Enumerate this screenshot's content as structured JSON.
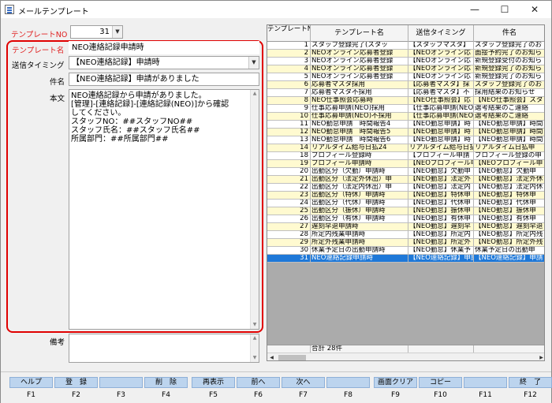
{
  "window": {
    "title": "メールテンプレート",
    "minimize_glyph": "—",
    "maximize_glyph": "☐",
    "close_glyph": "✕"
  },
  "form": {
    "template_no_label": "テンプレートNO",
    "template_no_value": "31",
    "template_name_label": "テンプレート名",
    "template_name_value": "NEO連絡記録申請時",
    "send_timing_label": "送信タイミング",
    "send_timing_value": "【NEO連絡記録】申請時",
    "subject_label": "件名",
    "subject_value": "【NEO連絡記録】申請がありました",
    "body_label": "本文",
    "body_lines": [
      "NEO連絡記録から申請がありました。",
      "[管理]-[連絡記録]-[連絡記録(NEO)]から確認",
      "してください。",
      "スタッフNO：##スタッフNO##",
      "スタッフ氏名：##スタッフ氏名##",
      "所属部門：##所属部門##"
    ],
    "notes_label": "備考",
    "notes_value": ""
  },
  "grid": {
    "columns": [
      "テンプレートNO",
      "テンプレート名",
      "送信タイミング",
      "件名"
    ],
    "rows": [
      {
        "no": "1",
        "name": "スタッフ登録完了(スタッ",
        "timing": "【スタッフマスタ】",
        "subject": "スタッフ登録完了のお",
        "color": "white"
      },
      {
        "no": "2",
        "name": "NEOオンライン応募者登録",
        "timing": "【NEOオンライン応",
        "subject": "面接予約完了のお知ら",
        "color": "yellow"
      },
      {
        "no": "3",
        "name": "NEOオンライン応募者登録",
        "timing": "【NEOオンライン応",
        "subject": "新規登録受付のお知ら",
        "color": "white"
      },
      {
        "no": "4",
        "name": "NEOオンライン応募者登録",
        "timing": "【NEOオンライン応",
        "subject": "新規登録完了のお知ら",
        "color": "yellow"
      },
      {
        "no": "5",
        "name": "NEOオンライン応募者登録",
        "timing": "【NEOオンライン応",
        "subject": "新規登録完了のお知ら",
        "color": "white"
      },
      {
        "no": "6",
        "name": "応募者マスタ採用",
        "timing": "【応募者マスタ】採",
        "subject": "スタッフ登録完了のお",
        "color": "yellow"
      },
      {
        "no": "7",
        "name": "応募者マスタ不採用",
        "timing": "【応募者マスタ】不",
        "subject": "採用結果のお知らせ",
        "color": "white"
      },
      {
        "no": "8",
        "name": "NEO仕事照会応募時",
        "timing": "【NEO仕事照会】応",
        "subject": "【NEO仕事照会】スタ",
        "color": "yellow"
      },
      {
        "no": "9",
        "name": "仕事応募申請(NEO)採用",
        "timing": "【仕事応募申請(NEO",
        "subject": "選考結果のご連絡",
        "color": "white"
      },
      {
        "no": "10",
        "name": "仕事応募申請(NEO)不採用",
        "timing": "【仕事応募申請(NEO",
        "subject": "選考結果のご連絡",
        "color": "yellow"
      },
      {
        "no": "11",
        "name": "NEO勤怠申請　時間報告4",
        "timing": "【NEO勤怠申請】時",
        "subject": "【NEO勤怠申請】時間",
        "color": "white"
      },
      {
        "no": "12",
        "name": "NEO勤怠申請　時間報告5",
        "timing": "【NEO勤怠申請】時",
        "subject": "【NEO勤怠申請】時間",
        "color": "yellow"
      },
      {
        "no": "13",
        "name": "NEO勤怠申請　時間報告6",
        "timing": "【NEO勤怠申請】時",
        "subject": "【NEO勤怠申請】時間",
        "color": "white"
      },
      {
        "no": "14",
        "name": "リアルタイム給与日払24",
        "timing": "リアルタイム給与日払",
        "subject": "リアルタイム日払申",
        "color": "yellow"
      },
      {
        "no": "18",
        "name": "プロフィール登録時",
        "timing": "【プロフィール申請",
        "subject": "プロフィール登録の申",
        "color": "white"
      },
      {
        "no": "19",
        "name": "プロフィール申請時",
        "timing": "【NEOプロフィール申",
        "subject": "【NEOプロフィール申",
        "color": "yellow"
      },
      {
        "no": "20",
        "name": "出勤区分（欠勤）申請時",
        "timing": "【NEO勤怠】欠勤申",
        "subject": "【NEO勤怠】欠勤申",
        "color": "white"
      },
      {
        "no": "21",
        "name": "出勤区分（法定外休出）申",
        "timing": "【NEO勤怠】法定外",
        "subject": "【NEO勤怠】法定外休",
        "color": "yellow"
      },
      {
        "no": "22",
        "name": "出勤区分（法定内休出）申",
        "timing": "【NEO勤怠】法定内",
        "subject": "【NEO勤怠】法定内休",
        "color": "white"
      },
      {
        "no": "23",
        "name": "出勤区分（特休）申請時",
        "timing": "【NEO勤怠】特休申",
        "subject": "【NEO勤怠】特休申",
        "color": "yellow"
      },
      {
        "no": "24",
        "name": "出勤区分（代休）申請時",
        "timing": "【NEO勤怠】代休申",
        "subject": "【NEO勤怠】代休申",
        "color": "white"
      },
      {
        "no": "25",
        "name": "出勤区分（振休）申請時",
        "timing": "【NEO勤怠】振休申",
        "subject": "【NEO勤怠】振休申",
        "color": "yellow"
      },
      {
        "no": "26",
        "name": "出勤区分（有休）申請時",
        "timing": "【NEO勤怠】有休申",
        "subject": "【NEO勤怠】有休申",
        "color": "white"
      },
      {
        "no": "27",
        "name": "遅刻早退申請時",
        "timing": "【NEO勤怠】遅刻早",
        "subject": "【NEO勤怠】遅刻早退",
        "color": "yellow"
      },
      {
        "no": "28",
        "name": "所定内残業申請時",
        "timing": "【NEO勤怠】所定内",
        "subject": "【NEO勤怠】所定内残",
        "color": "white"
      },
      {
        "no": "29",
        "name": "所定外残業申請時",
        "timing": "【NEO勤怠】所定外",
        "subject": "【NEO勤怠】所定外残",
        "color": "yellow"
      },
      {
        "no": "30",
        "name": "休業予定日の出勤申請時",
        "timing": "【NEO勤怠】休業予",
        "subject": "休業予定日の出勤申",
        "color": "white"
      },
      {
        "no": "31",
        "name": "NEO連絡記録申請時",
        "timing": "【NEO連絡記録】申請",
        "subject": "【NEO連絡記録】申請",
        "color": "selected"
      }
    ],
    "total_text": "合計 28件"
  },
  "fkeys": [
    {
      "label": "ヘルプ",
      "key": "F1"
    },
    {
      "label": "登　録",
      "key": "F2"
    },
    {
      "label": "",
      "key": "F3"
    },
    {
      "label": "削　除",
      "key": "F4"
    },
    {
      "label": "再表示",
      "key": "F5"
    },
    {
      "label": "前へ",
      "key": "F6"
    },
    {
      "label": "次へ",
      "key": "F7"
    },
    {
      "label": "",
      "key": "F8"
    },
    {
      "label": "画面クリア",
      "key": "F9"
    },
    {
      "label": "コピー",
      "key": "F10"
    },
    {
      "label": "",
      "key": "F11"
    },
    {
      "label": "終　了",
      "key": "F12"
    }
  ],
  "colors": {
    "required_label": "#e02020",
    "highlight_border": "#e00000",
    "row_yellow": "#fffad0",
    "row_selected": "#1e78d8",
    "fkey_bg": "#bcd4ee"
  }
}
